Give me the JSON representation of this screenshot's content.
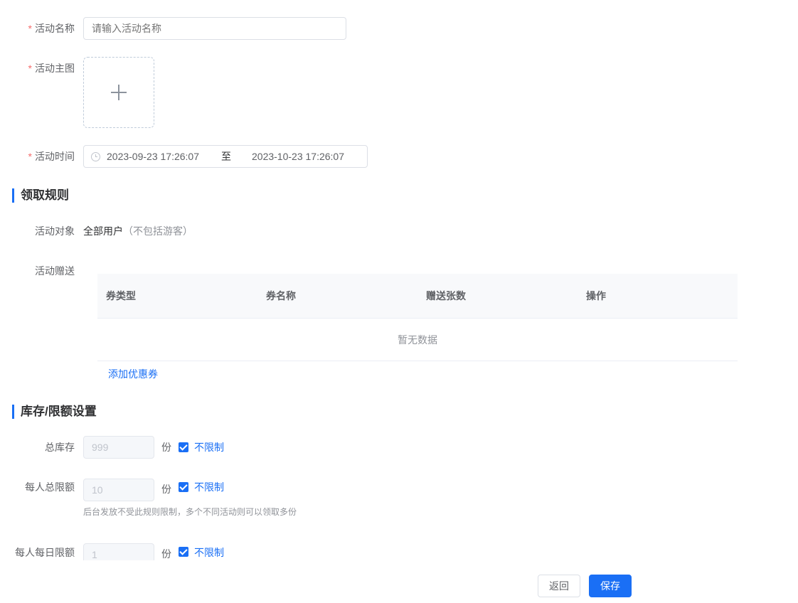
{
  "basic": {
    "name_label": "活动名称",
    "name_placeholder": "请输入活动名称",
    "image_label": "活动主图",
    "time_label": "活动时间",
    "start_time": "2023-09-23 17:26:07",
    "range_separator": "至",
    "end_time": "2023-10-23 17:26:07",
    "required_mark": "*"
  },
  "rules": {
    "title": "领取规则",
    "target_label": "活动对象",
    "target_value": "全部用户",
    "target_note": "（不包括游客）",
    "gift_label": "活动赠送",
    "table": {
      "columns": [
        "券类型",
        "券名称",
        "赠送张数",
        "操作"
      ],
      "rows": [],
      "empty_text": "暂无数据"
    },
    "add_coupon_link": "添加优惠券"
  },
  "limits": {
    "title": "库存/限额设置",
    "unit": "份",
    "unlimited_label": "不限制",
    "total_stock": {
      "label": "总库存",
      "value": "999",
      "unlimited": true
    },
    "per_user_total": {
      "label": "每人总限额",
      "value": "10",
      "unlimited": true,
      "hint": "后台发放不受此规则限制，多个不同活动则可以领取多份"
    },
    "per_user_daily": {
      "label": "每人每日限额",
      "value": "1",
      "unlimited": true
    }
  },
  "footer": {
    "back_label": "返回",
    "save_label": "保存"
  },
  "colors": {
    "primary": "#1a6ff5",
    "required": "#f56c6c"
  }
}
